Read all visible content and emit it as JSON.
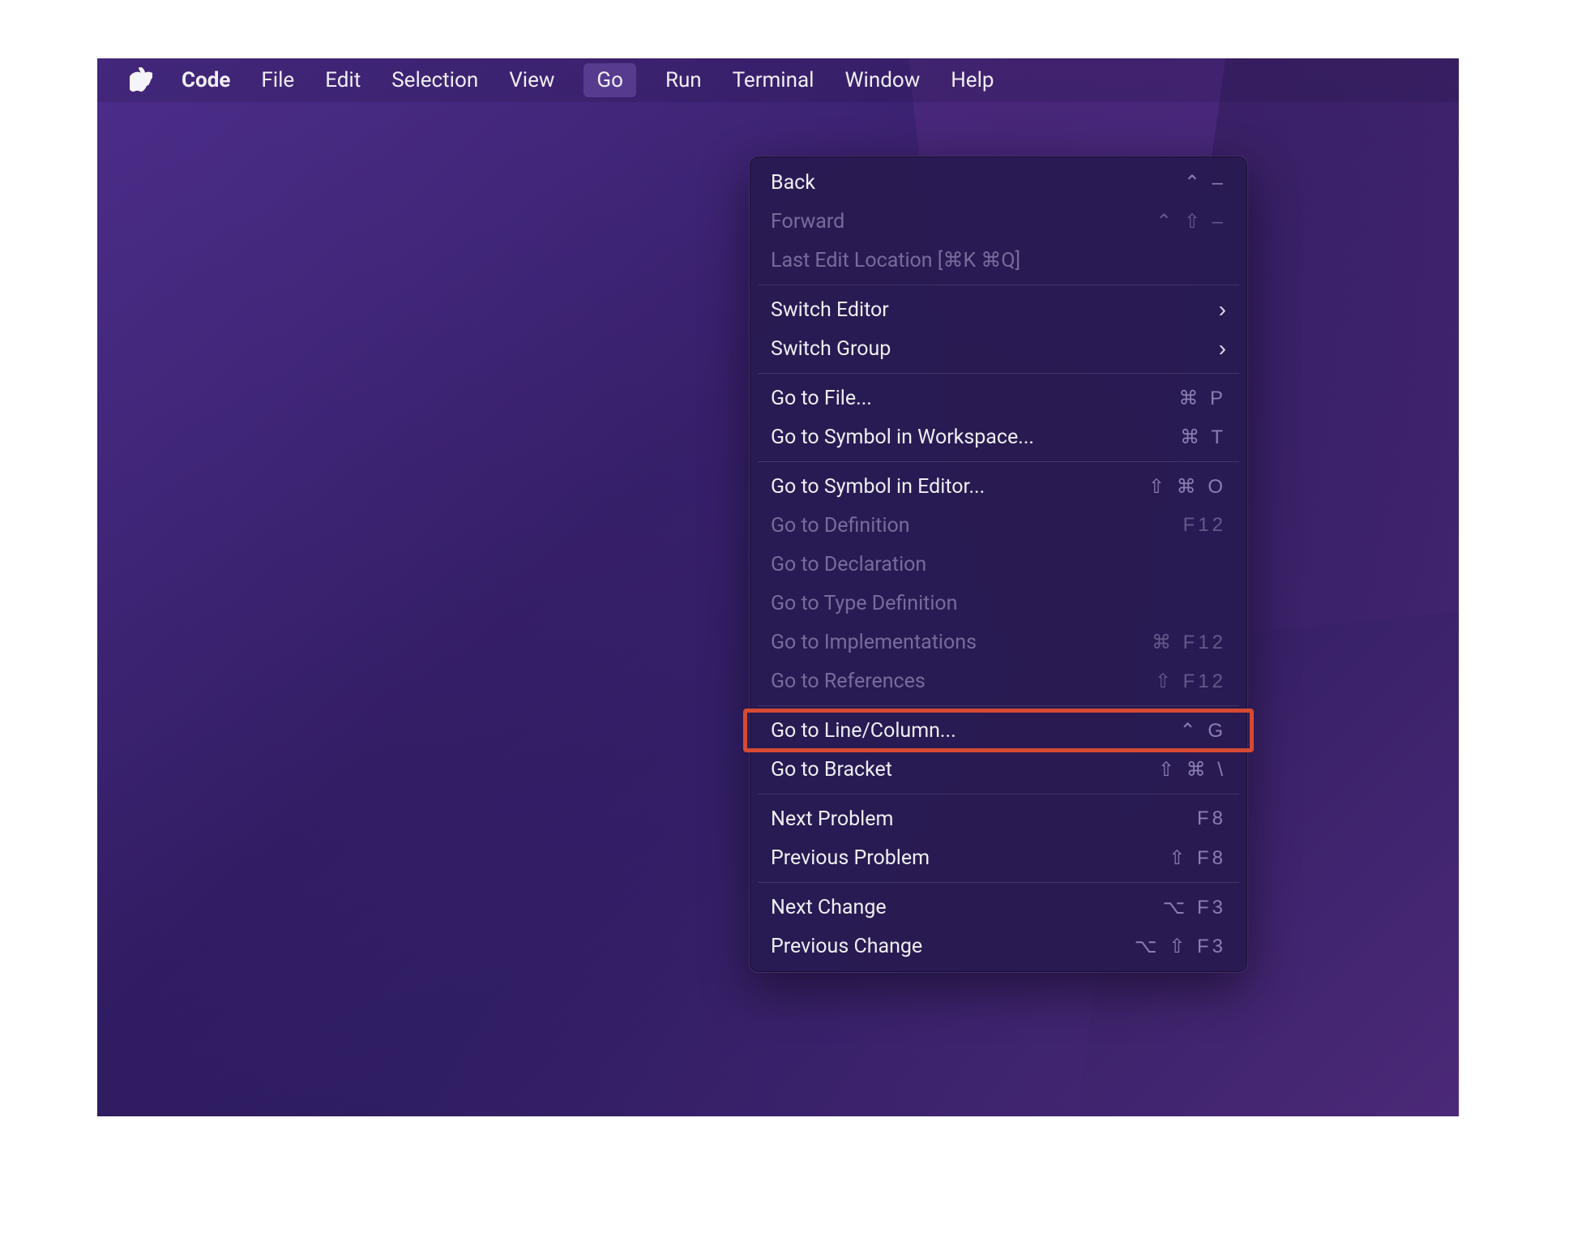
{
  "menubar": {
    "app": "Code",
    "items": [
      "File",
      "Edit",
      "Selection",
      "View",
      "Go",
      "Run",
      "Terminal",
      "Window",
      "Help"
    ],
    "active": "Go"
  },
  "dropdown": {
    "groups": [
      [
        {
          "label": "Back",
          "shortcut": "⌃ –",
          "disabled": false
        },
        {
          "label": "Forward",
          "shortcut": "⌃ ⇧ –",
          "disabled": true
        },
        {
          "label": "Last Edit Location [⌘K ⌘Q]",
          "shortcut": "",
          "disabled": true
        }
      ],
      [
        {
          "label": "Switch Editor",
          "submenu": true,
          "disabled": false
        },
        {
          "label": "Switch Group",
          "submenu": true,
          "disabled": false
        }
      ],
      [
        {
          "label": "Go to File...",
          "shortcut": "⌘ P",
          "disabled": false
        },
        {
          "label": "Go to Symbol in Workspace...",
          "shortcut": "⌘ T",
          "disabled": false
        }
      ],
      [
        {
          "label": "Go to Symbol in Editor...",
          "shortcut": "⇧ ⌘ O",
          "disabled": false
        },
        {
          "label": "Go to Definition",
          "shortcut": "F12",
          "disabled": true
        },
        {
          "label": "Go to Declaration",
          "shortcut": "",
          "disabled": true
        },
        {
          "label": "Go to Type Definition",
          "shortcut": "",
          "disabled": true
        },
        {
          "label": "Go to Implementations",
          "shortcut": "⌘ F12",
          "disabled": true
        },
        {
          "label": "Go to References",
          "shortcut": "⇧ F12",
          "disabled": true
        }
      ],
      [
        {
          "label": "Go to Line/Column...",
          "shortcut": "⌃ G",
          "disabled": false,
          "highlighted": true
        },
        {
          "label": "Go to Bracket",
          "shortcut": "⇧ ⌘ \\",
          "disabled": false
        }
      ],
      [
        {
          "label": "Next Problem",
          "shortcut": "F8",
          "disabled": false
        },
        {
          "label": "Previous Problem",
          "shortcut": "⇧ F8",
          "disabled": false
        }
      ],
      [
        {
          "label": "Next Change",
          "shortcut": "⌥ F3",
          "disabled": false
        },
        {
          "label": "Previous Change",
          "shortcut": "⌥ ⇧ F3",
          "disabled": false
        }
      ]
    ]
  }
}
